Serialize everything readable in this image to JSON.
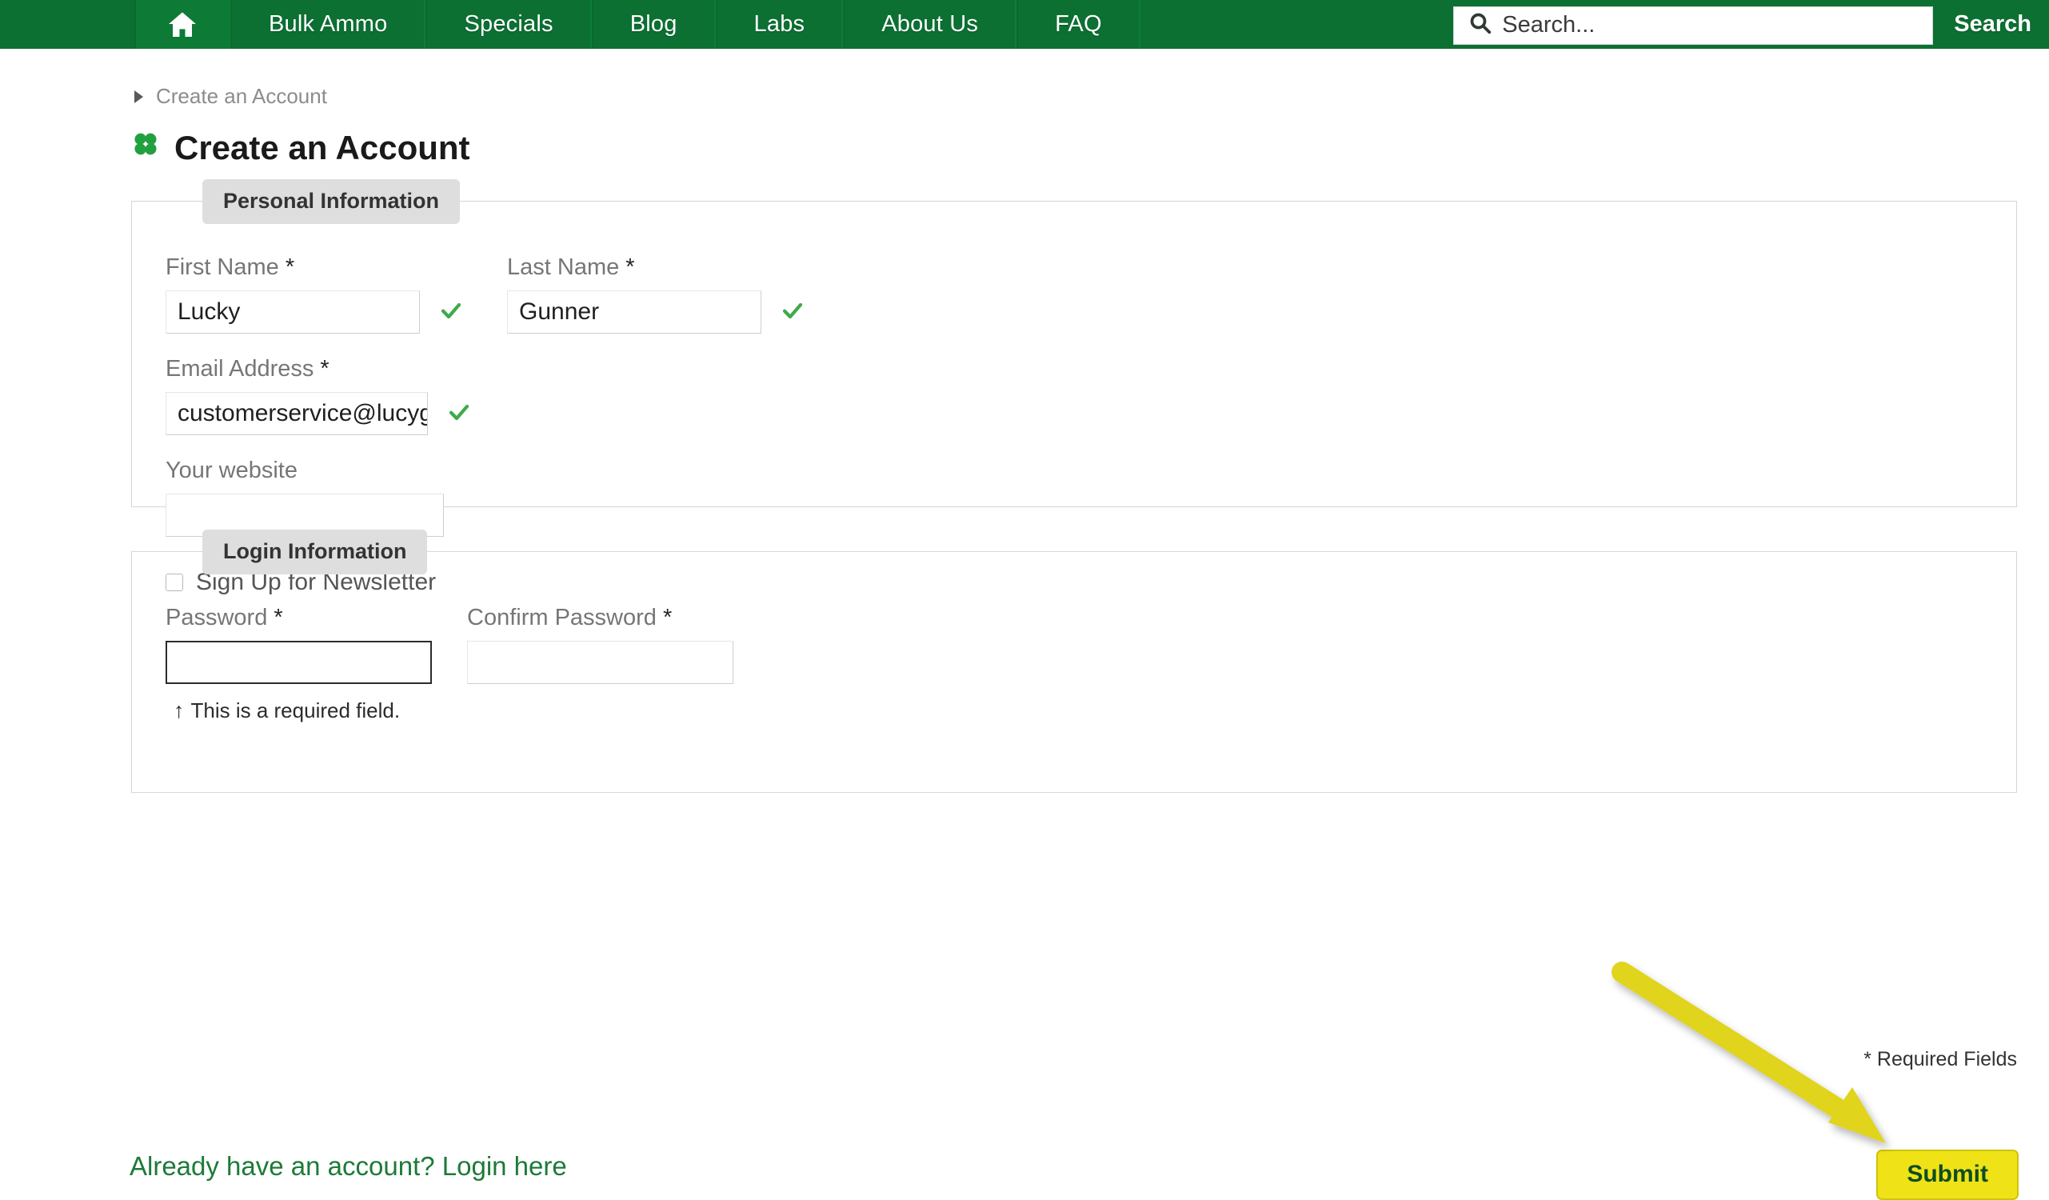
{
  "nav": {
    "home_icon": "home-icon",
    "items": [
      {
        "label": "Bulk Ammo"
      },
      {
        "label": "Specials"
      },
      {
        "label": "Blog"
      },
      {
        "label": "Labs"
      },
      {
        "label": "About Us"
      },
      {
        "label": "FAQ"
      }
    ],
    "search": {
      "icon": "search-icon",
      "placeholder": "Search...",
      "button_label": "Search"
    },
    "colors": {
      "bar": "#0b7032",
      "home_active": "#0d7a36"
    }
  },
  "breadcrumb": {
    "caret_icon": "caret-right-icon",
    "label": "Create an Account"
  },
  "page": {
    "icon": "clover-icon",
    "title": "Create an Account",
    "required_note": "* Required Fields",
    "login_link": "Already have an account? Login here",
    "submit_label": "Submit",
    "accent_green": "#0b7032",
    "submit_yellow": "#efe317",
    "submit_text_color": "#0f4d22"
  },
  "personal_information": {
    "legend": "Personal Information",
    "first_name": {
      "label": "First Name",
      "required_marker": "*",
      "value": "Lucky",
      "valid_icon": "check-icon"
    },
    "last_name": {
      "label": "Last Name",
      "required_marker": "*",
      "value": "Gunner",
      "valid_icon": "check-icon"
    },
    "email": {
      "label": "Email Address",
      "required_marker": "*",
      "value": "customerservice@lucygunner.c",
      "valid_icon": "check-icon"
    },
    "website": {
      "label": "Your website",
      "value": ""
    },
    "newsletter": {
      "label": "Sign Up for Newsletter",
      "checked": false
    }
  },
  "login_information": {
    "legend": "Login Information",
    "password": {
      "label": "Password",
      "required_marker": "*",
      "value": "",
      "error": "This is a required field.",
      "error_arrow": "↑"
    },
    "confirm_password": {
      "label": "Confirm Password",
      "required_marker": "*",
      "value": ""
    }
  },
  "annotation": {
    "arrow_icon": "arrow-pointer-icon",
    "color": "#e0d41f"
  }
}
